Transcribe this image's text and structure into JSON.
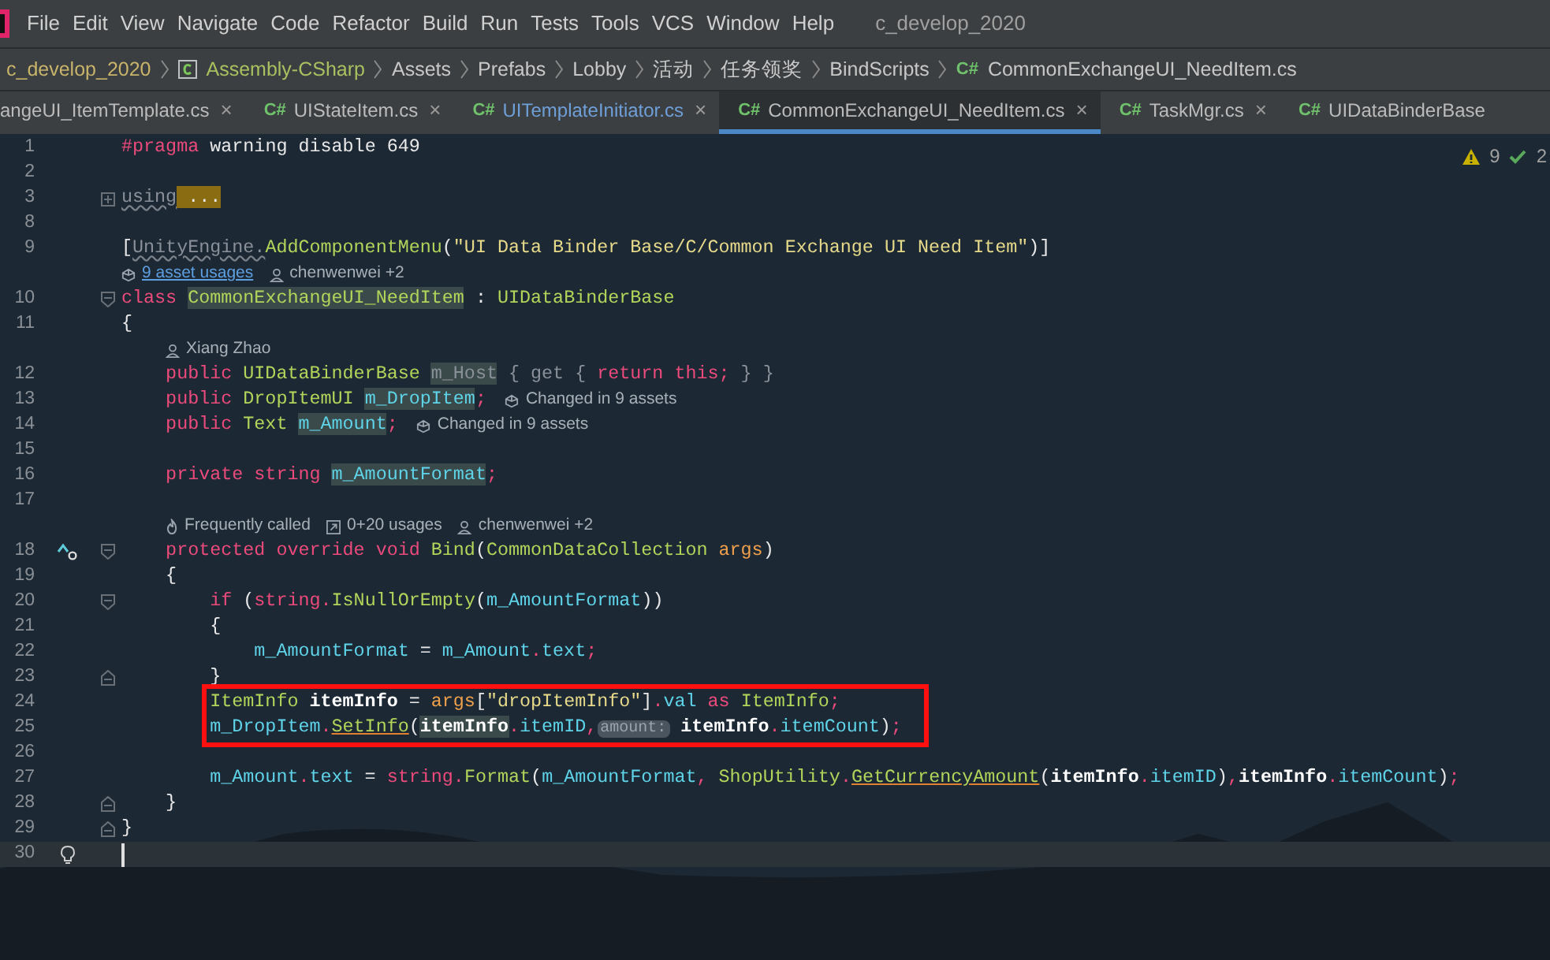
{
  "menu": {
    "items": [
      "File",
      "Edit",
      "View",
      "Navigate",
      "Code",
      "Refactor",
      "Build",
      "Run",
      "Tests",
      "Tools",
      "VCS",
      "Window",
      "Help"
    ],
    "project_title": "c_develop_2020"
  },
  "breadcrumb": [
    {
      "label": "c_develop_2020",
      "kind": "project"
    },
    {
      "label": "Assembly-CSharp",
      "kind": "assembly"
    },
    {
      "label": "Assets",
      "kind": "folder"
    },
    {
      "label": "Prefabs",
      "kind": "folder"
    },
    {
      "label": "Lobby",
      "kind": "folder"
    },
    {
      "label": "活动",
      "kind": "folder"
    },
    {
      "label": "任务领奖",
      "kind": "folder"
    },
    {
      "label": "BindScripts",
      "kind": "folder"
    },
    {
      "label": "CommonExchangeUI_NeedItem.cs",
      "kind": "file",
      "file_icon": "C#"
    }
  ],
  "tabs": [
    {
      "label": "angeUI_ItemTemplate.cs",
      "close": "×",
      "selected": false,
      "color": "#bbbbbb"
    },
    {
      "label": "UIStateItem.cs",
      "file_icon": "C#",
      "close": "×",
      "selected": false,
      "color": "#bbbbbb"
    },
    {
      "label": "UITemplateInitiator.cs",
      "file_icon": "C#",
      "close": "×",
      "selected": false,
      "color": "#6f9fd8"
    },
    {
      "label": "CommonExchangeUI_NeedItem.cs",
      "file_icon": "C#",
      "close": "×",
      "selected": true,
      "color": "#bbbbbb"
    },
    {
      "label": "TaskMgr.cs",
      "file_icon": "C#",
      "close": "×",
      "selected": false,
      "color": "#bbbbbb"
    },
    {
      "label": "UIDataBinderBase",
      "file_icon": "C#",
      "selected": false,
      "color": "#bbbbbb"
    }
  ],
  "inspections": {
    "warnings": "9",
    "ok": "2"
  },
  "code": [
    {
      "boxed": false,
      "rows": [
        {
          "kind": "line",
          "number": "1",
          "tokens": [
            {
              "text": "#pragma",
              "kind": "kw"
            },
            {
              "text": " warning disable 649",
              "kind": "plain"
            }
          ]
        },
        {
          "kind": "line",
          "number": "2",
          "tokens": []
        },
        {
          "kind": "line",
          "number": "3",
          "collapsed": true,
          "tokens": [
            {
              "text": "using",
              "kind": "dim-squiggle"
            },
            {
              "text": " ...",
              "kind": "folded"
            }
          ]
        },
        {
          "kind": "line",
          "number": "8",
          "tokens": []
        },
        {
          "kind": "line",
          "number": "9",
          "tokens": [
            {
              "text": "[",
              "kind": "plain"
            },
            {
              "text": "UnityEngine.",
              "kind": "dim-squiggle"
            },
            {
              "text": "AddComponentMenu",
              "kind": "type"
            },
            {
              "text": "(",
              "kind": "plain"
            },
            {
              "text": "\"UI Data Binder Base/C/Common Exchange UI Need Item\"",
              "kind": "str"
            },
            {
              "text": ")]",
              "kind": "plain"
            }
          ]
        },
        {
          "kind": "hints",
          "items": [
            {
              "kind": "assets",
              "text": "9 asset usages",
              "link": true
            },
            {
              "kind": "author",
              "text": "chenwenwei +2",
              "link": false
            }
          ]
        },
        {
          "kind": "line",
          "number": "10",
          "block_start": true,
          "tokens": [
            {
              "text": "class ",
              "kind": "kw"
            },
            {
              "text": "CommonExchangeUI_NeedItem",
              "kind": "type-highlight"
            },
            {
              "text": " : ",
              "kind": "plain"
            },
            {
              "text": "UIDataBinderBase",
              "kind": "type"
            }
          ]
        },
        {
          "kind": "line",
          "number": "11",
          "tokens": [
            {
              "text": "{",
              "kind": "plain"
            }
          ]
        },
        {
          "kind": "hints",
          "items": [
            {
              "kind": "author",
              "text": "Xiang Zhao",
              "link": false
            }
          ]
        },
        {
          "kind": "line",
          "number": "12",
          "tokens": [
            {
              "text": "    public ",
              "kind": "kw"
            },
            {
              "text": "UIDataBinderBase ",
              "kind": "type"
            },
            {
              "text": "m_Host",
              "kind": "dim-highlight"
            },
            {
              "text": " { get { ",
              "kind": "dim"
            },
            {
              "text": "return this;",
              "kind": "kw"
            },
            {
              "text": " } }",
              "kind": "dim"
            }
          ]
        },
        {
          "kind": "line",
          "number": "13",
          "tokens": [
            {
              "text": "    public ",
              "kind": "kw"
            },
            {
              "text": "DropItemUI ",
              "kind": "type"
            },
            {
              "text": "m_DropItem",
              "kind": "field-highlight"
            },
            {
              "text": ";",
              "kind": "kw"
            }
          ],
          "inline_hint": {
            "kind": "assets",
            "text": "Changed in 9 assets"
          }
        },
        {
          "kind": "line",
          "number": "14",
          "tokens": [
            {
              "text": "    public ",
              "kind": "kw"
            },
            {
              "text": "Text ",
              "kind": "type"
            },
            {
              "text": "m_Amount",
              "kind": "field-highlight"
            },
            {
              "text": ";",
              "kind": "kw"
            }
          ],
          "inline_hint": {
            "kind": "assets",
            "text": "Changed in 9 assets"
          }
        },
        {
          "kind": "line",
          "number": "15",
          "tokens": []
        },
        {
          "kind": "line",
          "number": "16",
          "tokens": [
            {
              "text": "    private string ",
              "kind": "kw"
            },
            {
              "text": "m_AmountFormat",
              "kind": "field-highlight"
            },
            {
              "text": ";",
              "kind": "kw"
            }
          ]
        },
        {
          "kind": "line",
          "number": "17",
          "tokens": []
        },
        {
          "kind": "hints",
          "items": [
            {
              "kind": "hot",
              "text": "Frequently called",
              "link": false
            },
            {
              "kind": "usages",
              "text": "0+20 usages",
              "link": false
            },
            {
              "kind": "author",
              "text": "chenwenwei +2",
              "link": false
            }
          ]
        },
        {
          "kind": "line",
          "number": "18",
          "overrides": true,
          "block_start": true,
          "tokens": [
            {
              "text": "    protected override void ",
              "kind": "kw"
            },
            {
              "text": "Bind",
              "kind": "type"
            },
            {
              "text": "(",
              "kind": "plain"
            },
            {
              "text": "CommonDataCollection",
              "kind": "type"
            },
            {
              "text": " args",
              "kind": "param"
            },
            {
              "text": ")",
              "kind": "plain"
            }
          ]
        },
        {
          "kind": "line",
          "number": "19",
          "tokens": [
            {
              "text": "    {",
              "kind": "plain"
            }
          ]
        },
        {
          "kind": "line",
          "number": "20",
          "block_start": true,
          "tokens": [
            {
              "text": "        if",
              "kind": "kw"
            },
            {
              "text": " (",
              "kind": "plain"
            },
            {
              "text": "string.",
              "kind": "kw"
            },
            {
              "text": "IsNullOrEmpty",
              "kind": "type"
            },
            {
              "text": "(",
              "kind": "plain"
            },
            {
              "text": "m_AmountFormat",
              "kind": "field"
            },
            {
              "text": "))",
              "kind": "plain"
            }
          ]
        },
        {
          "kind": "line",
          "number": "21",
          "tokens": [
            {
              "text": "        {",
              "kind": "plain"
            }
          ]
        },
        {
          "kind": "line",
          "number": "22",
          "tokens": [
            {
              "text": "            m_AmountFormat",
              "kind": "field"
            },
            {
              "text": " = ",
              "kind": "plain"
            },
            {
              "text": "m_Amount",
              "kind": "field"
            },
            {
              "text": ".",
              "kind": "kw"
            },
            {
              "text": "text",
              "kind": "field"
            },
            {
              "text": ";",
              "kind": "kw"
            }
          ]
        },
        {
          "kind": "line",
          "number": "23",
          "block_end": true,
          "tokens": [
            {
              "text": "        }",
              "kind": "plain"
            }
          ]
        }
      ]
    },
    {
      "boxed": true,
      "rows": [
        {
          "kind": "line",
          "number": "24",
          "tokens": [
            {
              "text": "        ItemInfo",
              "kind": "type"
            },
            {
              "text": " itemInfo",
              "kind": "local"
            },
            {
              "text": " = ",
              "kind": "plain"
            },
            {
              "text": "args",
              "kind": "param"
            },
            {
              "text": "[",
              "kind": "plain"
            },
            {
              "text": "\"dropItemInfo\"",
              "kind": "str"
            },
            {
              "text": "]",
              "kind": "plain"
            },
            {
              "text": ".",
              "kind": "kw"
            },
            {
              "text": "val",
              "kind": "field"
            },
            {
              "text": " as ",
              "kind": "kw"
            },
            {
              "text": "ItemInfo",
              "kind": "type"
            },
            {
              "text": ";",
              "kind": "kw"
            }
          ]
        },
        {
          "kind": "line",
          "number": "25",
          "tokens": [
            {
              "text": "        m_DropItem",
              "kind": "field"
            },
            {
              "text": ".",
              "kind": "kw"
            },
            {
              "text": "SetInfo",
              "kind": "type-underline"
            },
            {
              "text": "(",
              "kind": "plain"
            },
            {
              "text": "itemInfo",
              "kind": "local-highlight"
            },
            {
              "text": ".",
              "kind": "kw"
            },
            {
              "text": "itemID",
              "kind": "field"
            },
            {
              "text": ",",
              "kind": "kw"
            },
            {
              "text": "amount:",
              "kind": "inlay"
            },
            {
              "text": " itemInfo",
              "kind": "local"
            },
            {
              "text": ".",
              "kind": "kw"
            },
            {
              "text": "itemCount",
              "kind": "field"
            },
            {
              "text": ")",
              "kind": "plain"
            },
            {
              "text": ";",
              "kind": "kw"
            }
          ]
        }
      ]
    },
    {
      "boxed": false,
      "rows": [
        {
          "kind": "line",
          "number": "26",
          "tokens": []
        },
        {
          "kind": "line",
          "number": "27",
          "tokens": [
            {
              "text": "        m_Amount",
              "kind": "field"
            },
            {
              "text": ".",
              "kind": "kw"
            },
            {
              "text": "text",
              "kind": "field"
            },
            {
              "text": " = ",
              "kind": "plain"
            },
            {
              "text": "string.",
              "kind": "kw"
            },
            {
              "text": "Format",
              "kind": "type"
            },
            {
              "text": "(",
              "kind": "plain"
            },
            {
              "text": "m_AmountFormat",
              "kind": "field"
            },
            {
              "text": ", ",
              "kind": "kw"
            },
            {
              "text": "ShopUtility",
              "kind": "type"
            },
            {
              "text": ".",
              "kind": "kw"
            },
            {
              "text": "GetCurrencyAmount",
              "kind": "type-underline"
            },
            {
              "text": "(",
              "kind": "plain"
            },
            {
              "text": "itemInfo",
              "kind": "local"
            },
            {
              "text": ".",
              "kind": "kw"
            },
            {
              "text": "itemID",
              "kind": "field"
            },
            {
              "text": ")",
              "kind": "plain"
            },
            {
              "text": ",",
              "kind": "kw"
            },
            {
              "text": "itemInfo",
              "kind": "local"
            },
            {
              "text": ".",
              "kind": "kw"
            },
            {
              "text": "itemCount",
              "kind": "field"
            },
            {
              "text": ")",
              "kind": "plain"
            },
            {
              "text": ";",
              "kind": "kw"
            }
          ]
        },
        {
          "kind": "line",
          "number": "28",
          "block_end": true,
          "tokens": [
            {
              "text": "    }",
              "kind": "plain"
            }
          ]
        },
        {
          "kind": "line",
          "number": "29",
          "block_end": true,
          "tokens": [
            {
              "text": "}",
              "kind": "plain"
            }
          ]
        },
        {
          "kind": "line",
          "number": "30",
          "intention": true,
          "current": true,
          "tokens": []
        }
      ]
    }
  ]
}
